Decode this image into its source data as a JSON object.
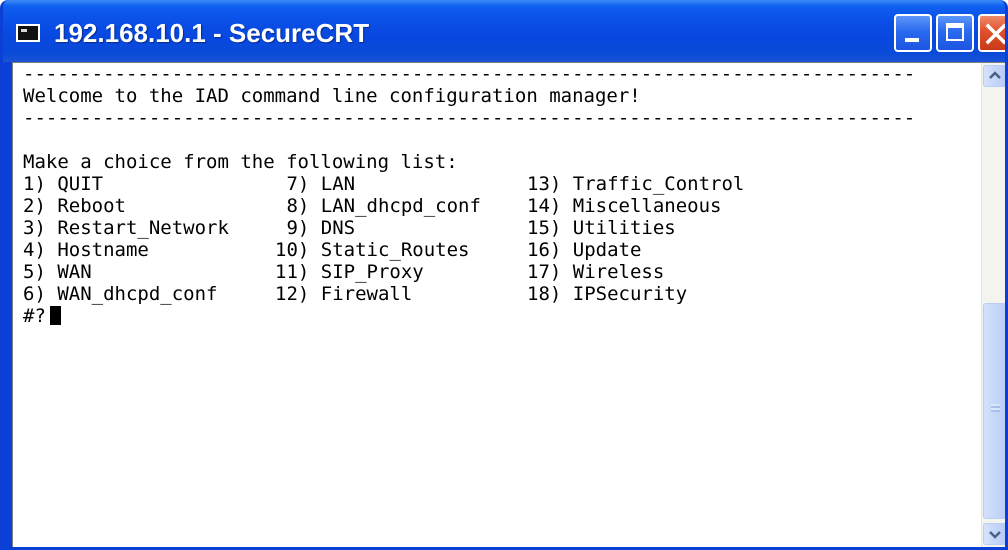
{
  "window": {
    "title": "192.168.10.1 - SecureCRT",
    "icon": "terminal-app-icon",
    "buttons": {
      "minimize": "minimize-icon",
      "maximize": "maximize-icon",
      "close": "close-icon"
    }
  },
  "terminal": {
    "separator_top": "------------------------------------------------------------------------------",
    "welcome": "Welcome to the IAD command line configuration manager!",
    "separator_bottom": "------------------------------------------------------------------------------",
    "menu_heading": "Make a choice from the following list:",
    "menu_rows": [
      [
        "1) QUIT",
        " 7) LAN",
        "13) Traffic_Control"
      ],
      [
        "2) Reboot",
        " 8) LAN_dhcpd_conf",
        "14) Miscellaneous"
      ],
      [
        "3) Restart_Network",
        " 9) DNS",
        "15) Utilities"
      ],
      [
        "4) Hostname",
        "10) Static_Routes",
        "16) Update"
      ],
      [
        "5) WAN",
        "11) SIP_Proxy",
        "17) Wireless"
      ],
      [
        "6) WAN_dhcpd_conf",
        "12) Firewall",
        "18) IPSecurity"
      ]
    ],
    "prompt": "#?"
  },
  "scrollbar": {
    "up_icon": "scroll-up-icon",
    "down_icon": "scroll-down-icon",
    "thumb_grip_icon": "grip-icon",
    "position_fraction": 0.58
  },
  "colors": {
    "titlebar": "#0a4fe6",
    "close_button": "#e0502c",
    "terminal_background": "#ffffff",
    "terminal_text": "#000000"
  }
}
